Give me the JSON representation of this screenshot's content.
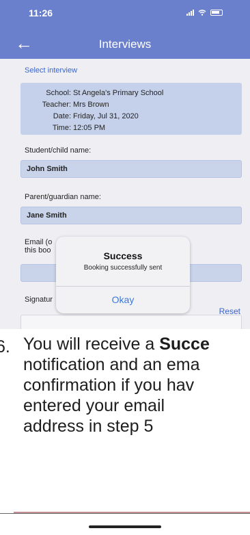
{
  "status_bar": {
    "time": "11:26"
  },
  "nav": {
    "title": "Interviews"
  },
  "select_interview_label": "Select interview",
  "interview": [
    {
      "label": "School:",
      "value": "St Angela's Primary School"
    },
    {
      "label": "Teacher:",
      "value": "Mrs Brown"
    },
    {
      "label": "Date:",
      "value": "Friday, Jul 31, 2020"
    },
    {
      "label": "Time:",
      "value": "12:05 PM"
    }
  ],
  "fields": {
    "student_label": "Student/child name:",
    "student_value": "John Smith",
    "parent_label": "Parent/guardian name:",
    "parent_value": "Jane Smith",
    "email_label_line1": "Email (o",
    "email_label_line2": "this boo",
    "signature_label": "Signatur",
    "reset": "Reset"
  },
  "alert": {
    "title": "Success",
    "message": "Booking successfully sent",
    "button": "Okay"
  },
  "instruction": {
    "number": "6.",
    "line1_prefix": "You will receive a ",
    "line1_bold": "Succe",
    "line2": "notification and an ema",
    "line3": "confirmation if you hav",
    "line4": "entered your email",
    "line5": "address in step 5"
  },
  "colors": {
    "accent": "#6a80cc",
    "link": "#3a64c9",
    "field": "#c9d3ea"
  }
}
